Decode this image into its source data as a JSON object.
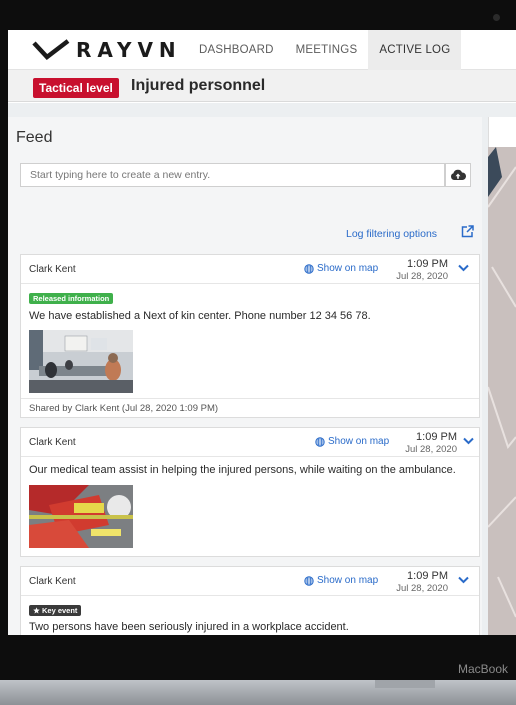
{
  "app": {
    "logo_text": "RAYVN"
  },
  "nav": {
    "items": [
      {
        "label": "DASHBOARD"
      },
      {
        "label": "MEETINGS"
      },
      {
        "label": "ACTIVE LOG"
      }
    ],
    "active": "ACTIVE LOG"
  },
  "incident": {
    "level_badge": "Tactical level",
    "title": "Injured personnel"
  },
  "feed": {
    "heading": "Feed",
    "input_placeholder": "Start typing here to create a new entry.",
    "filter_link": "Log filtering options",
    "entries": [
      {
        "author": "Clark Kent",
        "map_link": "Show on map",
        "time": "1:09 PM",
        "date": "Jul 28, 2020",
        "tag": "Released information",
        "text": "We have established a Next of kin center. Phone number 12 34 56 78.",
        "shared_by": "Shared by  Clark Kent (Jul 28, 2020 1:09 PM)"
      },
      {
        "author": "Clark Kent",
        "map_link": "Show on map",
        "time": "1:09 PM",
        "date": "Jul 28, 2020",
        "text": "Our medical team assist in helping the injured persons, while waiting on the ambulance."
      },
      {
        "author": "Clark Kent",
        "map_link": "Show on map",
        "time": "1:09 PM",
        "date": "Jul 28, 2020",
        "tag": "Key event",
        "text": "Two persons have been seriously injured in a workplace accident."
      }
    ]
  },
  "device": {
    "brand": "MacBook"
  },
  "colors": {
    "tactical_red": "#c8102e",
    "released_green": "#3fb04b",
    "link_blue": "#2a6bc9",
    "key_event_dark": "#3a3a3a"
  },
  "icons": {
    "upload": "cloud-upload-icon",
    "external": "external-link-icon",
    "globe": "globe-icon",
    "chevron": "chevron-down-icon",
    "star": "star-icon"
  }
}
